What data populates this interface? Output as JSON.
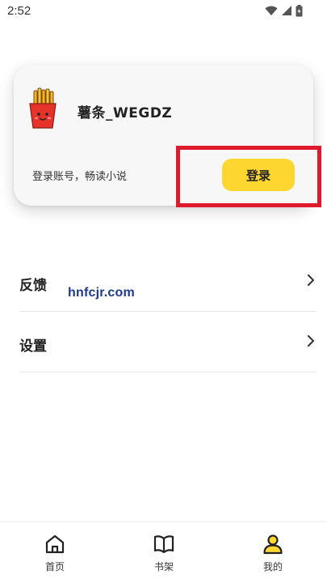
{
  "status_bar": {
    "time": "2:52",
    "icons": [
      "wifi-icon",
      "signal-icon",
      "battery-icon"
    ]
  },
  "user_card": {
    "avatar_icon": "french-fries-icon",
    "username": "薯条_WEGDZ",
    "login_hint": "登录账号，畅读小说",
    "login_button_label": "登录"
  },
  "menu": {
    "items": [
      {
        "label": "反馈",
        "icon": "chevron-right-icon"
      },
      {
        "label": "设置",
        "icon": "chevron-right-icon"
      }
    ]
  },
  "watermark": "hnfcjr.com",
  "bottom_nav": {
    "items": [
      {
        "label": "首页",
        "icon": "home-icon",
        "active": false
      },
      {
        "label": "书架",
        "icon": "book-icon",
        "active": false
      },
      {
        "label": "我的",
        "icon": "user-icon",
        "active": true
      }
    ]
  },
  "colors": {
    "accent": "#fdd630",
    "highlight": "#e0192c",
    "watermark": "#1d3a8f"
  }
}
